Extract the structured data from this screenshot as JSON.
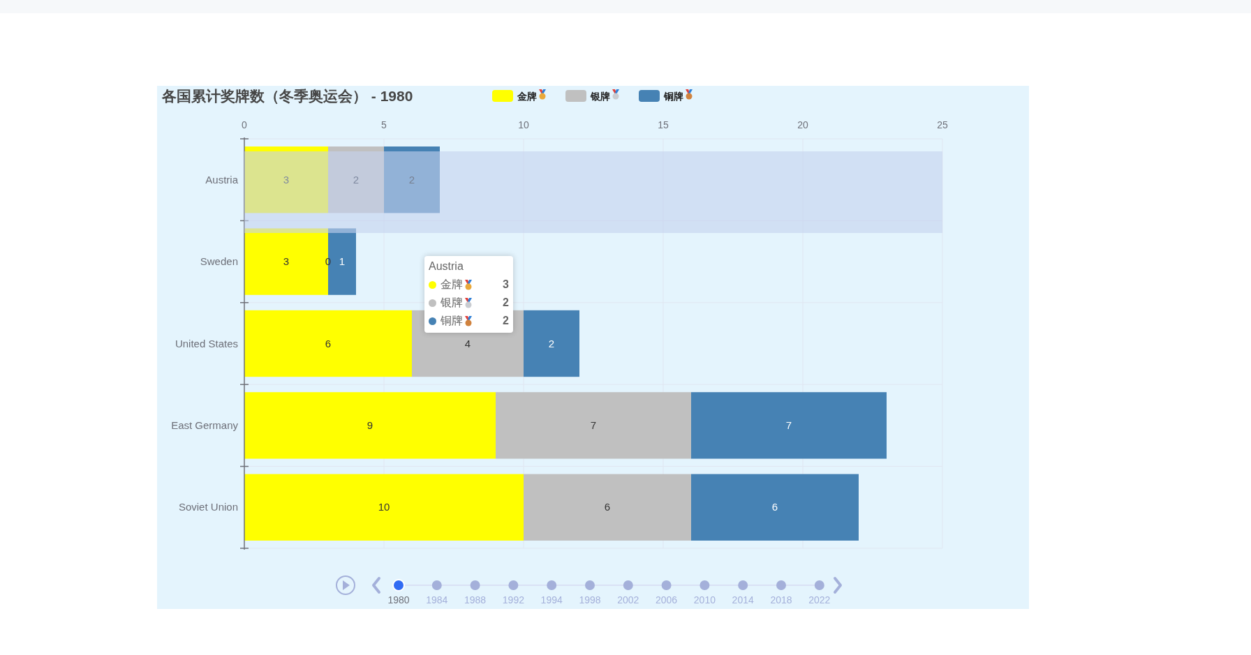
{
  "chart": {
    "title": "各国累计奖牌数（冬季奥运会） - 1980",
    "chart_data": {
      "type": "bar",
      "orientation": "horizontal",
      "stacked": true,
      "data_labels": true,
      "categories": [
        "Austria",
        "Sweden",
        "United States",
        "East Germany",
        "Soviet Union"
      ],
      "series": [
        {
          "name": "金牌",
          "color": "#ffff00",
          "values": [
            3,
            3,
            6,
            9,
            10
          ]
        },
        {
          "name": "银牌",
          "color": "#c0c0c0",
          "values": [
            2,
            0,
            4,
            7,
            6
          ]
        },
        {
          "name": "铜牌",
          "color": "#4682b4",
          "values": [
            2,
            1,
            2,
            7,
            6
          ]
        }
      ],
      "xlim": [
        0,
        25
      ],
      "xticks": [
        0,
        5,
        10,
        15,
        20,
        25
      ],
      "grid": true,
      "legend": true
    }
  },
  "tooltip": {
    "title": "Austria",
    "rows": [
      {
        "label": "金牌",
        "value": "3",
        "color": "#ffff00"
      },
      {
        "label": "银牌",
        "value": "2",
        "color": "#c0c0c0"
      },
      {
        "label": "铜牌",
        "value": "2",
        "color": "#4682b4"
      }
    ]
  },
  "timeline": {
    "years": [
      {
        "label": "1980",
        "selected": true
      },
      {
        "label": "1984",
        "selected": false
      },
      {
        "label": "1988",
        "selected": false
      },
      {
        "label": "1992",
        "selected": false
      },
      {
        "label": "1994",
        "selected": false
      },
      {
        "label": "1998",
        "selected": false
      },
      {
        "label": "2002",
        "selected": false
      },
      {
        "label": "2006",
        "selected": false
      },
      {
        "label": "2010",
        "selected": false
      },
      {
        "label": "2014",
        "selected": false
      },
      {
        "label": "2018",
        "selected": false
      },
      {
        "label": "2022",
        "selected": false
      }
    ]
  }
}
